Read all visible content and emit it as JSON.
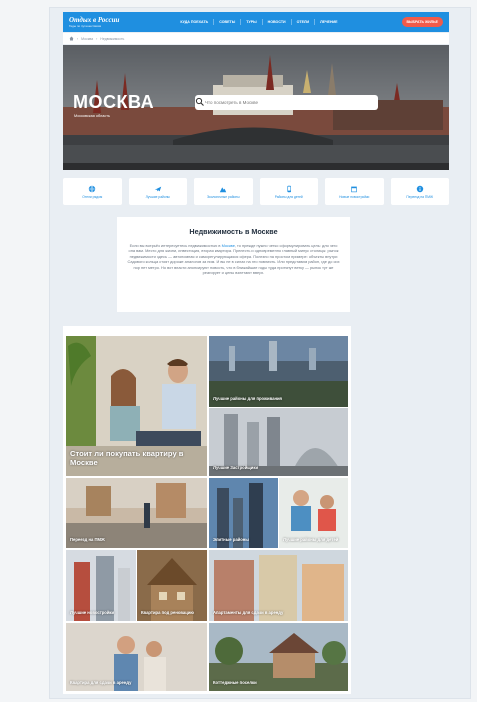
{
  "header": {
    "logo_title": "Отдых в России",
    "logo_subtitle": "Гиды по путешествиям",
    "nav": [
      "КУДА ПОЕХАТЬ",
      "СОВЕТЫ",
      "ТУРЫ",
      "НОВОСТИ",
      "ОТЕЛИ",
      "ЛЕЧЕНИЕ"
    ],
    "cta_label": "ВЫБРАТЬ ЖИЛЬЕ"
  },
  "breadcrumbs": [
    "Москва",
    "Недвижимость"
  ],
  "hero": {
    "city": "МОСКВА",
    "region": "Московская область",
    "search_placeholder": "Что посмотреть в Москве"
  },
  "quick_links": [
    {
      "label": "Отели рядом",
      "icon": "globe-icon"
    },
    {
      "label": "Лучшие районы",
      "icon": "plane-icon"
    },
    {
      "label": "Экологичные районы",
      "icon": "mountain-icon"
    },
    {
      "label": "Районы для детей",
      "icon": "phone-icon"
    },
    {
      "label": "Новые новостройки",
      "icon": "calendar-icon"
    },
    {
      "label": "Переезд на ПМЖ",
      "icon": "info-icon"
    }
  ],
  "about": {
    "title": "Недвижимость в Москве",
    "text_before": "Если вы всерьёз интересуетесь недвижимостью в",
    "text_link": "Москве",
    "text_after": ", то прежде нужно четко сформулировать цель: для чего она вам. Место для жизни, инвестиция, вторая квартира. Прелесть и одновременно главный минус столицы: рынок недвижимости здесь — автономная и саморегулирующаяся сфера. Полезно на простом примере: объекты внутри Садового кольца стоят дороже аналогов за ним. И вы не в силах на это повлиять. Или представим район, где до сих пор нет метро. Но вот власти анонсируют новость, что в ближайшие годы туда протянут ветку — рынок тут же реагирует и цены взлетают вверх."
  },
  "tiles": [
    {
      "caption": "Стоит ли покупать квартиру в Москве"
    },
    {
      "caption": "Лучшие районы для проживания"
    },
    {
      "caption": "Лучшие Застройщики"
    },
    {
      "caption": "Переезд на ПМЖ"
    },
    {
      "caption": "Элитные районы"
    },
    {
      "caption": "Лучшие районы для детей"
    },
    {
      "caption": "Лучшие новостройки"
    },
    {
      "caption": "Квартира под реновацию"
    },
    {
      "caption": "Апартаменты для сдачи в аренду"
    },
    {
      "caption": "Квартира для сдачи в аренду"
    },
    {
      "caption": "Коттеджные поселки"
    }
  ],
  "colors": {
    "accent": "#1f8fe0",
    "cta": "#f25b4a"
  }
}
